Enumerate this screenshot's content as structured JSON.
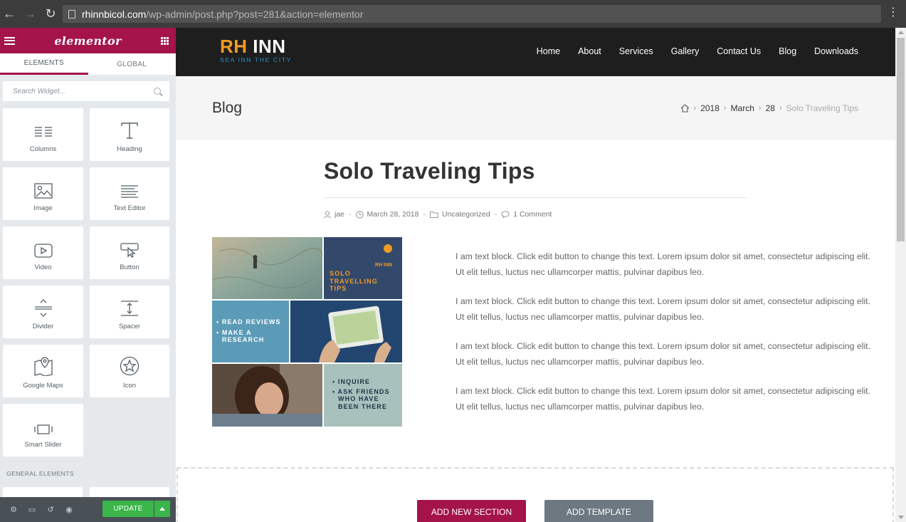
{
  "browser": {
    "url_host": "rhinnbicol.com",
    "url_path": "/wp-admin/post.php?post=281&action=elementor"
  },
  "panel": {
    "brand": "elementor",
    "tabs": [
      "ELEMENTS",
      "GLOBAL"
    ],
    "active_tab": "ELEMENTS",
    "search_placeholder": "Search Widget...",
    "widgets": [
      {
        "label": "Columns",
        "icon": "columns-icon"
      },
      {
        "label": "Heading",
        "icon": "heading-icon"
      },
      {
        "label": "Image",
        "icon": "image-icon"
      },
      {
        "label": "Text Editor",
        "icon": "text-editor-icon"
      },
      {
        "label": "Video",
        "icon": "video-icon"
      },
      {
        "label": "Button",
        "icon": "button-icon"
      },
      {
        "label": "Divider",
        "icon": "divider-icon"
      },
      {
        "label": "Spacer",
        "icon": "spacer-icon"
      },
      {
        "label": "Google Maps",
        "icon": "map-icon"
      },
      {
        "label": "Icon",
        "icon": "star-icon"
      },
      {
        "label": "Smart Slider",
        "icon": "slider-icon"
      }
    ],
    "general_heading": "GENERAL ELEMENTS",
    "footer": {
      "update_label": "UPDATE"
    }
  },
  "site": {
    "logo": {
      "rh": "RH",
      "inn": "INN",
      "tagline": "SEA INN THE CITY"
    },
    "nav": [
      "Home",
      "About",
      "Services",
      "Gallery",
      "Contact Us",
      "Blog",
      "Downloads"
    ],
    "page_title": "Blog",
    "breadcrumb": [
      "2018",
      "March",
      "28",
      "Solo Traveling Tips"
    ],
    "post": {
      "title": "Solo Traveling Tips",
      "author": "jae",
      "date": "March 28, 2018",
      "category": "Uncategorized",
      "comments": "1 Comment"
    },
    "collage": {
      "tile1": [
        "SOLO",
        "TRAVELLING",
        "TIPS"
      ],
      "tile2": [
        "• READ REVIEWS",
        "• MAKE A",
        "RESEARCH"
      ],
      "tile3": [
        "• INQUIRE",
        "• ASK FRIENDS",
        "WHO HAVE",
        "BEEN THERE"
      ],
      "mini_logo": "RH INN"
    },
    "paragraphs": [
      "I am text block. Click edit button to change this text. Lorem ipsum dolor sit amet, consectetur adipiscing elit. Ut elit tellus, luctus nec ullamcorper mattis, pulvinar dapibus leo.",
      "I am text block. Click edit button to change this text. Lorem ipsum dolor sit amet, consectetur adipiscing elit. Ut elit tellus, luctus nec ullamcorper mattis, pulvinar dapibus leo.",
      "I am text block. Click edit button to change this text. Lorem ipsum dolor sit amet, consectetur adipiscing elit. Ut elit tellus, luctus nec ullamcorper mattis, pulvinar dapibus leo.",
      "I am text block. Click edit button to change this text. Lorem ipsum dolor sit amet, consectetur adipiscing elit. Ut elit tellus, luctus nec ullamcorper mattis, pulvinar dapibus leo."
    ],
    "add_section_label": "ADD NEW SECTION",
    "add_template_label": "ADD TEMPLATE"
  },
  "colors": {
    "elementor_accent": "#a4134a",
    "update_green": "#39b54a",
    "logo_orange": "#f29a24",
    "header_dark": "#1e1e1e"
  }
}
